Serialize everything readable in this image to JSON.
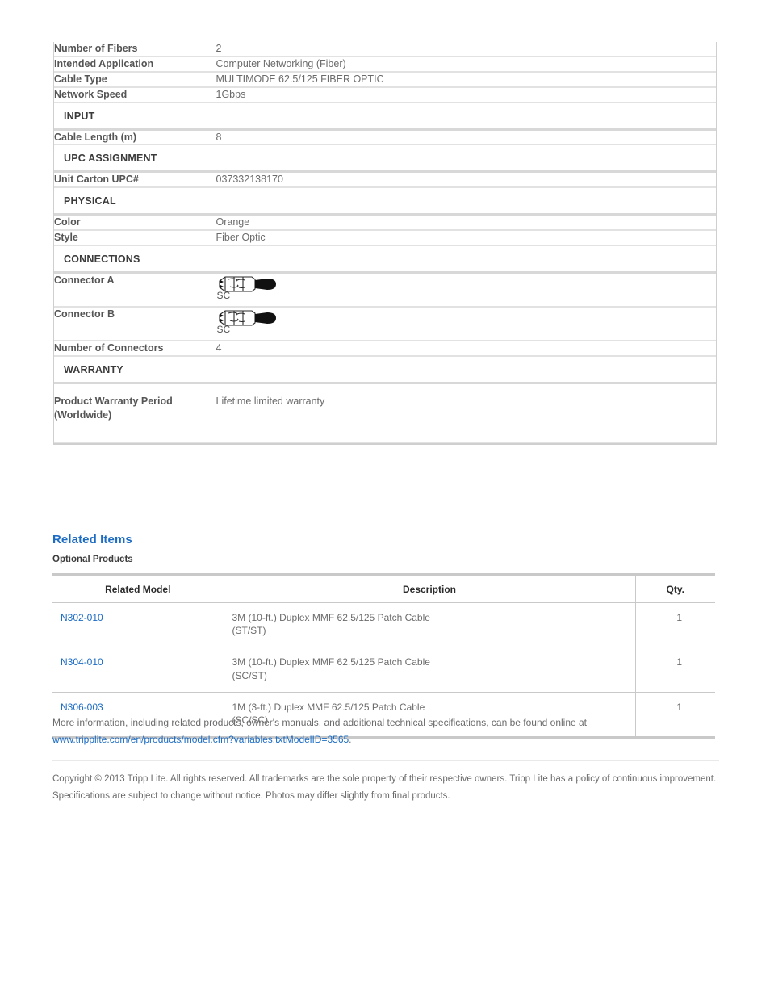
{
  "spec_table": {
    "rows": [
      {
        "kind": "row",
        "label": "Number of Fibers",
        "value": "2"
      },
      {
        "kind": "row",
        "label": "Intended Application",
        "value": "Computer Networking (Fiber)"
      },
      {
        "kind": "row",
        "label": "Cable Type",
        "value": "MULTIMODE 62.5/125 FIBER OPTIC"
      },
      {
        "kind": "row",
        "label": "Network Speed",
        "value": "1Gbps"
      },
      {
        "kind": "section",
        "label": "INPUT"
      },
      {
        "kind": "row",
        "label": "Cable Length (m)",
        "value": "8"
      },
      {
        "kind": "section",
        "label": "UPC ASSIGNMENT"
      },
      {
        "kind": "row",
        "label": "Unit Carton UPC#",
        "value": "037332138170"
      },
      {
        "kind": "section",
        "label": "PHYSICAL"
      },
      {
        "kind": "row",
        "label": "Color",
        "value": "Orange"
      },
      {
        "kind": "row",
        "label": "Style",
        "value": "Fiber Optic"
      },
      {
        "kind": "section",
        "label": "CONNECTIONS"
      },
      {
        "kind": "image",
        "label": "Connector A",
        "value": "SC",
        "icon": "sc-fiber-connector-icon"
      },
      {
        "kind": "image",
        "label": "Connector B",
        "value": "SC",
        "icon": "sc-fiber-connector-icon"
      },
      {
        "kind": "row",
        "label": "Number of Connectors",
        "value": "4"
      },
      {
        "kind": "section",
        "label": "WARRANTY"
      },
      {
        "kind": "tall",
        "label": "Product Warranty Period (Worldwide)",
        "value": "Lifetime limited warranty"
      }
    ]
  },
  "related": {
    "heading": "Related Items",
    "subheading": "Optional Products",
    "columns": [
      "Related Model",
      "Description",
      "Qty."
    ],
    "rows": [
      {
        "model": "N302-010",
        "description": "3M (10-ft.) Duplex MMF 62.5/125 Patch Cable (ST/ST)",
        "qty": "1"
      },
      {
        "model": "N304-010",
        "description": "3M (10-ft.) Duplex MMF 62.5/125 Patch Cable (SC/ST)",
        "qty": "1"
      },
      {
        "model": "N306-003",
        "description": "1M (3-ft.) Duplex MMF 62.5/125 Patch Cable (SC/SC)",
        "qty": "1"
      }
    ]
  },
  "footer": {
    "more_info_text": "More information, including related products, owner's manuals, and additional technical specifications, can be found online at ",
    "url": "www.tripplite.com/en/products/model.cfm?variables.txtModelID=3565",
    "url_period": ".",
    "copyright": "Copyright © 2013 Tripp Lite. All rights reserved. All trademarks are the sole property of their respective owners. Tripp Lite has a policy of continuous improvement. Specifications are subject to change without notice. Photos may differ slightly from final products."
  },
  "colors": {
    "link_blue": "#1c6cc4",
    "label_gray": "#555555",
    "value_gray": "#6b6b6b",
    "border_gray": "#c9c9c9"
  }
}
